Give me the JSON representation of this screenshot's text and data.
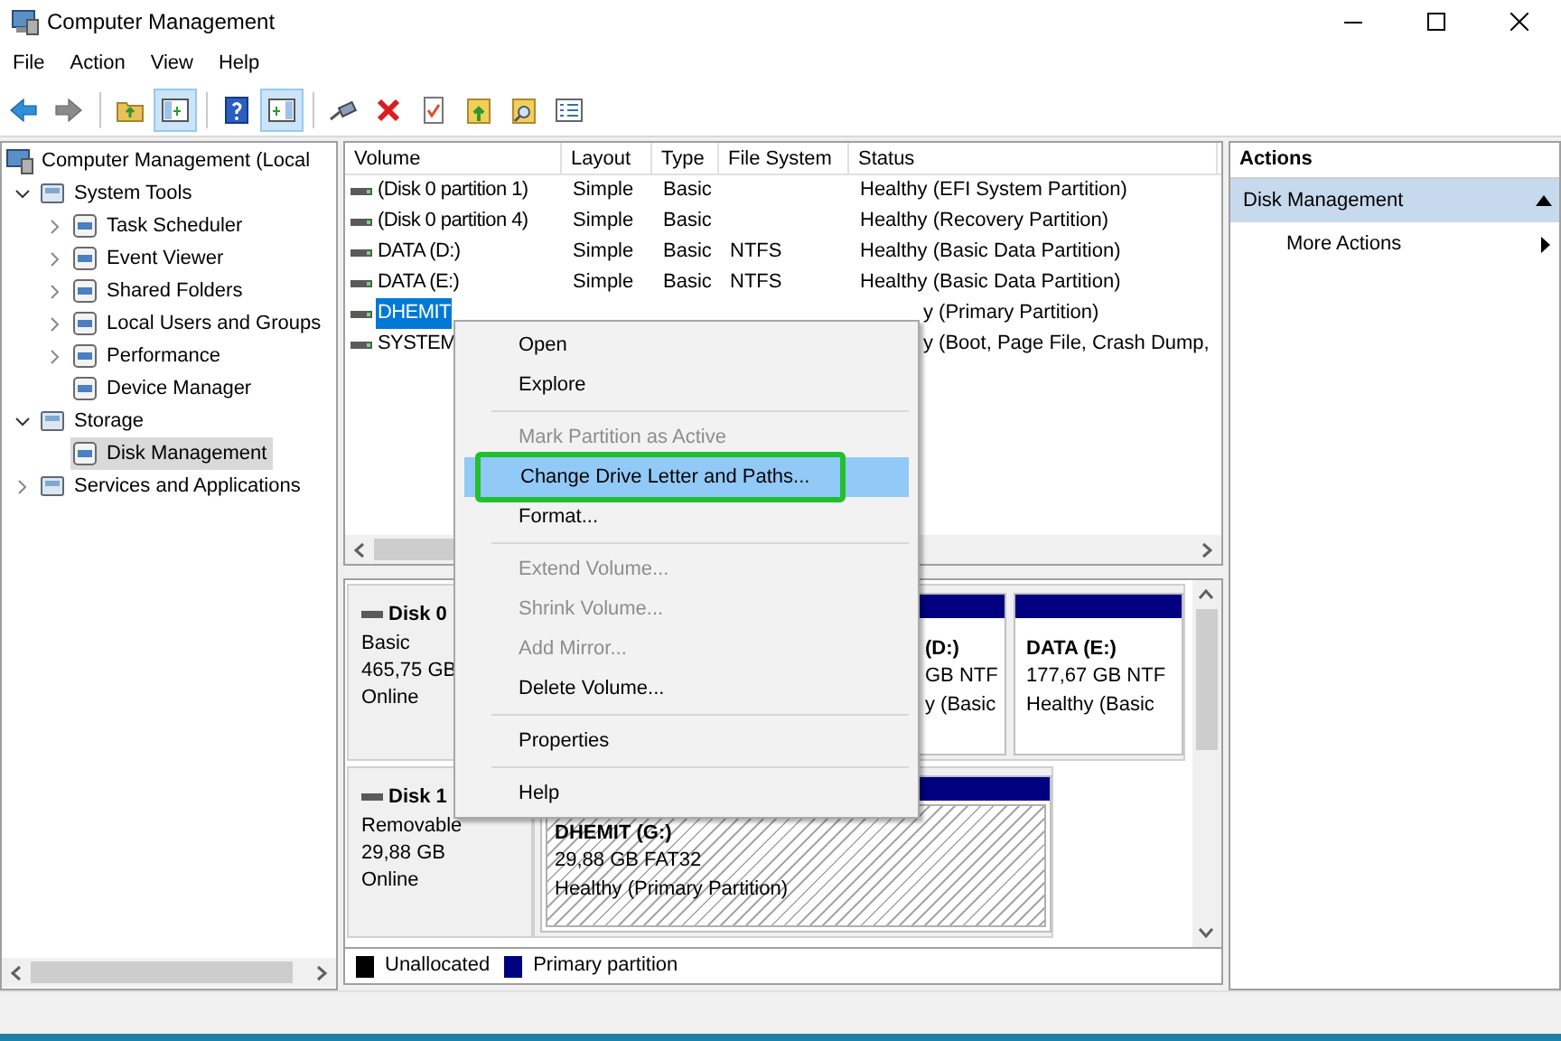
{
  "window": {
    "title": "Computer Management"
  },
  "menu_bar": [
    "File",
    "Action",
    "View",
    "Help"
  ],
  "toolbar": [
    {
      "kind": "back",
      "pressed": false
    },
    {
      "kind": "forward",
      "pressed": false
    },
    {
      "kind": "separator"
    },
    {
      "kind": "folder-up",
      "pressed": false
    },
    {
      "kind": "tree-toggle",
      "pressed": true
    },
    {
      "kind": "separator"
    },
    {
      "kind": "help",
      "pressed": false
    },
    {
      "kind": "pane-toggle",
      "pressed": true
    },
    {
      "kind": "separator"
    },
    {
      "kind": "connect",
      "pressed": false
    },
    {
      "kind": "delete",
      "pressed": false
    },
    {
      "kind": "properties",
      "pressed": false
    },
    {
      "kind": "folder-arrow",
      "pressed": false
    },
    {
      "kind": "folder-search",
      "pressed": false
    },
    {
      "kind": "list",
      "pressed": false
    }
  ],
  "tree": {
    "label": "Computer Management (Local",
    "selected": false,
    "children": [
      {
        "label": "System Tools",
        "expanded": true,
        "selected": false,
        "children": [
          {
            "label": "Task Scheduler",
            "expanded": false,
            "selected": false
          },
          {
            "label": "Event Viewer",
            "expanded": false,
            "selected": false
          },
          {
            "label": "Shared Folders",
            "expanded": false,
            "selected": false
          },
          {
            "label": "Local Users and Groups",
            "expanded": false,
            "selected": false
          },
          {
            "label": "Performance",
            "expanded": false,
            "selected": false
          },
          {
            "label": "Device Manager",
            "selected": false
          }
        ]
      },
      {
        "label": "Storage",
        "expanded": true,
        "selected": false,
        "children": [
          {
            "label": "Disk Management",
            "selected": true
          }
        ]
      },
      {
        "label": "Services and Applications",
        "expanded": false,
        "selected": false
      }
    ]
  },
  "table": {
    "columns": [
      "Volume",
      "Layout",
      "Type",
      "File System",
      "Status"
    ],
    "rows": [
      {
        "volume": "(Disk 0 partition 1)",
        "layout": "Simple",
        "type": "Basic",
        "status": "Healthy (EFI System Partition)",
        "selected": false
      },
      {
        "volume": "(Disk 0 partition 4)",
        "layout": "Simple",
        "type": "Basic",
        "status": "Healthy (Recovery Partition)",
        "selected": false
      },
      {
        "volume": "DATA (D:)",
        "layout": "Simple",
        "type": "Basic",
        "file_system": "NTFS",
        "status": "Healthy (Basic Data Partition)",
        "selected": false
      },
      {
        "volume": "DATA (E:)",
        "layout": "Simple",
        "type": "Basic",
        "file_system": "NTFS",
        "status": "Healthy (Basic Data Partition)",
        "selected": false
      },
      {
        "volume": "DHEMIT",
        "status": "y (Primary Partition)",
        "selected": true
      },
      {
        "volume": "SYSTEM",
        "status": "y (Boot, Page File, Crash Dump,",
        "selected": false
      }
    ]
  },
  "context_menu": [
    {
      "kind": "item",
      "label": "Open",
      "disabled": false,
      "highlighted": false,
      "outlined": false
    },
    {
      "kind": "item",
      "label": "Explore",
      "disabled": false,
      "highlighted": false,
      "outlined": false
    },
    {
      "kind": "separator"
    },
    {
      "kind": "item",
      "label": "Mark Partition as Active",
      "disabled": true,
      "highlighted": false,
      "outlined": false
    },
    {
      "kind": "item",
      "label": "Change Drive Letter and Paths...",
      "disabled": false,
      "highlighted": true,
      "outlined": true
    },
    {
      "kind": "item",
      "label": "Format...",
      "disabled": false,
      "highlighted": false,
      "outlined": false
    },
    {
      "kind": "separator"
    },
    {
      "kind": "item",
      "label": "Extend Volume...",
      "disabled": true,
      "highlighted": false,
      "outlined": false
    },
    {
      "kind": "item",
      "label": "Shrink Volume...",
      "disabled": true,
      "highlighted": false,
      "outlined": false
    },
    {
      "kind": "item",
      "label": "Add Mirror...",
      "disabled": true,
      "highlighted": false,
      "outlined": false
    },
    {
      "kind": "item",
      "label": "Delete Volume...",
      "disabled": false,
      "highlighted": false,
      "outlined": false
    },
    {
      "kind": "separator"
    },
    {
      "kind": "item",
      "label": "Properties",
      "disabled": false,
      "highlighted": false,
      "outlined": false
    },
    {
      "kind": "separator"
    },
    {
      "kind": "item",
      "label": "Help",
      "disabled": false,
      "highlighted": false,
      "outlined": false
    }
  ],
  "disks": [
    {
      "name": "Disk 0",
      "type": "Basic",
      "size": "465,75 GB",
      "status": "Online",
      "partitions": [
        {
          "name": "(D:)",
          "size": "GB NTF",
          "status": "y (Basic",
          "selected": false
        },
        {
          "name": "DATA  (E:)",
          "size": "177,67 GB NTF",
          "status": "Healthy (Basic",
          "selected": false
        }
      ]
    },
    {
      "name": "Disk 1",
      "type": "Removable",
      "size": "29,88 GB",
      "status": "Online",
      "partitions": [
        {
          "name": "DHEMIT  (G:)",
          "size": "29,88 GB FAT32",
          "status": "Healthy (Primary Partition)",
          "selected": true
        }
      ]
    }
  ],
  "legend": [
    {
      "label": "Unallocated",
      "color": "#000000"
    },
    {
      "label": "Primary partition",
      "color": "#000080"
    }
  ],
  "actions": {
    "title": "Actions",
    "sections": [
      {
        "label": "Disk Management",
        "expanded": true,
        "items": [
          "More Actions"
        ]
      }
    ]
  }
}
